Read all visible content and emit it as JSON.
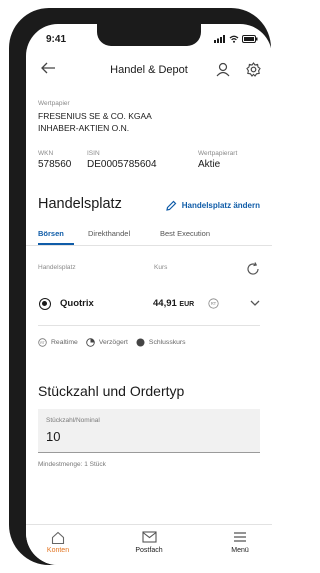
{
  "status": {
    "time": "9:41"
  },
  "header": {
    "title": "Handel & Depot"
  },
  "security": {
    "label": "Wertpapier",
    "name_line1": "FRESENIUS SE & CO. KGAA",
    "name_line2": "INHABER-AKTIEN O.N.",
    "wkn_label": "WKN",
    "wkn": "578560",
    "isin_label": "ISIN",
    "isin": "DE0005785604",
    "type_label": "Wertpapierart",
    "type": "Aktie"
  },
  "trading": {
    "heading": "Handelsplatz",
    "change_link": "Handelsplatz ändern",
    "tabs": [
      {
        "label": "Börsen",
        "active": true
      },
      {
        "label": "Direkthandel",
        "active": false
      },
      {
        "label": "Best Execution",
        "active": false
      }
    ],
    "col_venue": "Handelsplatz",
    "col_price": "Kurs",
    "row": {
      "venue": "Quotrix",
      "price": "44,91",
      "currency": "EUR",
      "badge": "RT"
    },
    "legend": {
      "realtime": "Realtime",
      "delayed": "Verzögert",
      "closing": "Schlusskurs"
    }
  },
  "order": {
    "heading": "Stückzahl und Ordertyp",
    "qty_label": "Stückzahl/Nominal",
    "qty_value": "10",
    "min_qty": "Mindestmenge: 1 Stück"
  },
  "bottom_nav": [
    {
      "label": "Konten",
      "icon": "home-icon",
      "active": true
    },
    {
      "label": "Postfach",
      "icon": "mail-icon",
      "active": false
    },
    {
      "label": "Menü",
      "icon": "menu-icon",
      "active": false
    }
  ],
  "colors": {
    "accent": "#0f5ca8",
    "active_nav": "#e2731f",
    "phone_frame": "#1b1b1b"
  }
}
